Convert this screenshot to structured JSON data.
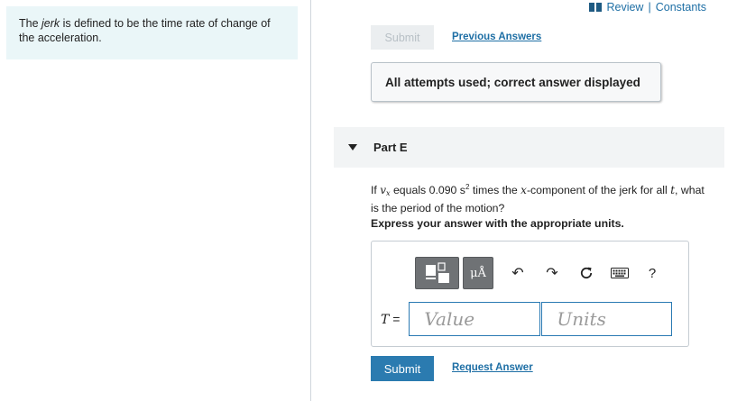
{
  "hint": {
    "prefix": "The ",
    "emphasis": "jerk",
    "suffix": " is defined to be the time rate of change of the acceleration."
  },
  "header_links": {
    "review": "Review",
    "separator": "|",
    "constants": "Constants"
  },
  "previous_part": {
    "submit_label": "Submit",
    "previous_answers_label": "Previous Answers",
    "status_message": "All attempts used; correct answer displayed"
  },
  "part_e": {
    "title": "Part E",
    "question": {
      "t1": "If ",
      "v_sym": "v",
      "v_sub": "x",
      "t2": " equals 0.090 s",
      "exp": "2",
      "t3": " times the ",
      "x_sym": "x",
      "t4": "-component of the jerk for all ",
      "t_sym": "t",
      "t5": ", what is the period of the motion?"
    },
    "instruction": "Express your answer with the appropriate units.",
    "toolbar": {
      "units_label": "μÅ",
      "undo_icon": "↶",
      "redo_icon": "↷",
      "help_label": "?"
    },
    "answer": {
      "variable": "T",
      "equals": "=",
      "value_placeholder": "Value",
      "units_placeholder": "Units"
    },
    "submit_label": "Submit",
    "request_answer_label": "Request Answer"
  },
  "colors": {
    "link": "#1e6fa5",
    "hint_bg": "#eaf6f8",
    "submit_bg": "#2b7bb0",
    "toolbar_btn": "#6f7275"
  }
}
